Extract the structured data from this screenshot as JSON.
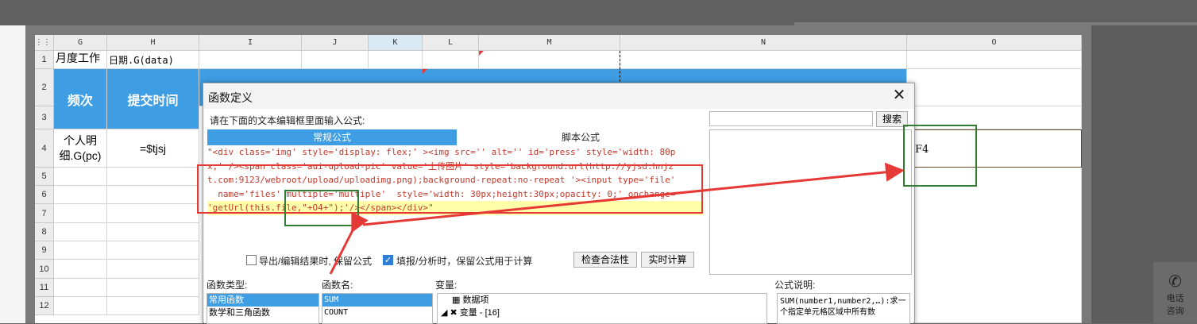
{
  "columns": [
    "G",
    "H",
    "I",
    "J",
    "K",
    "L",
    "M",
    "N",
    "O"
  ],
  "rows": [
    "1",
    "2",
    "3",
    "4",
    "5",
    "6",
    "7",
    "8",
    "9",
    "10",
    "11",
    "12"
  ],
  "cells": {
    "g1": "月度工作",
    "h1": "日期.G(data)",
    "g2": "频次",
    "h2": "提交时间",
    "g4": "个人明细.G(pc)",
    "h4": "=$tjsj"
  },
  "dialog": {
    "title": "函数定义",
    "prompt": "请在下面的文本编辑框里面输入公式:",
    "search_button": "搜索",
    "tab_regular": "常规公式",
    "tab_script": "脚本公式",
    "formula_lines": [
      "\"<div class='img' style='display: flex;' ><img src='' alt='' id='press' style='width: 80p",
      "x;' /><span class='aui-upload-pic' value='上传图片' style='background:url(http://yjsd.hnjz",
      "t.com:9123/webroot/upload/uploadimg.png);background-repeat:no-repeat '><input type='file'",
      "  name='files' multiple='multiple'  style='width: 30px;height:30px;opacity: 0;' onchange=",
      "'getUrl(this.file,\"+O4+\");'/></span></div>\""
    ],
    "preview_value": "F4",
    "option_export": "导出/编辑结果时, 保留公式",
    "option_fill": "填报/分析时，保留公式用于计算",
    "check_button": "检查合法性",
    "realtime_button": "实时计算",
    "func_type_label": "函数类型:",
    "func_types": [
      "常用函数",
      "数学和三角函数"
    ],
    "func_name_label": "函数名:",
    "func_names": [
      "SUM",
      "COUNT"
    ],
    "var_label": "变量:",
    "var_items": [
      "数据项",
      "变量 - [16]"
    ],
    "desc_label": "公式说明:",
    "desc_text": "SUM(number1,number2,…):求一个指定单元格区域中所有数"
  },
  "side_help": {
    "label_line1": "电话",
    "label_line2": "咨询"
  },
  "colors": {
    "header_blue": "#3f9de3",
    "annotation_red": "#e53935",
    "annotation_green": "#2e7d32"
  }
}
